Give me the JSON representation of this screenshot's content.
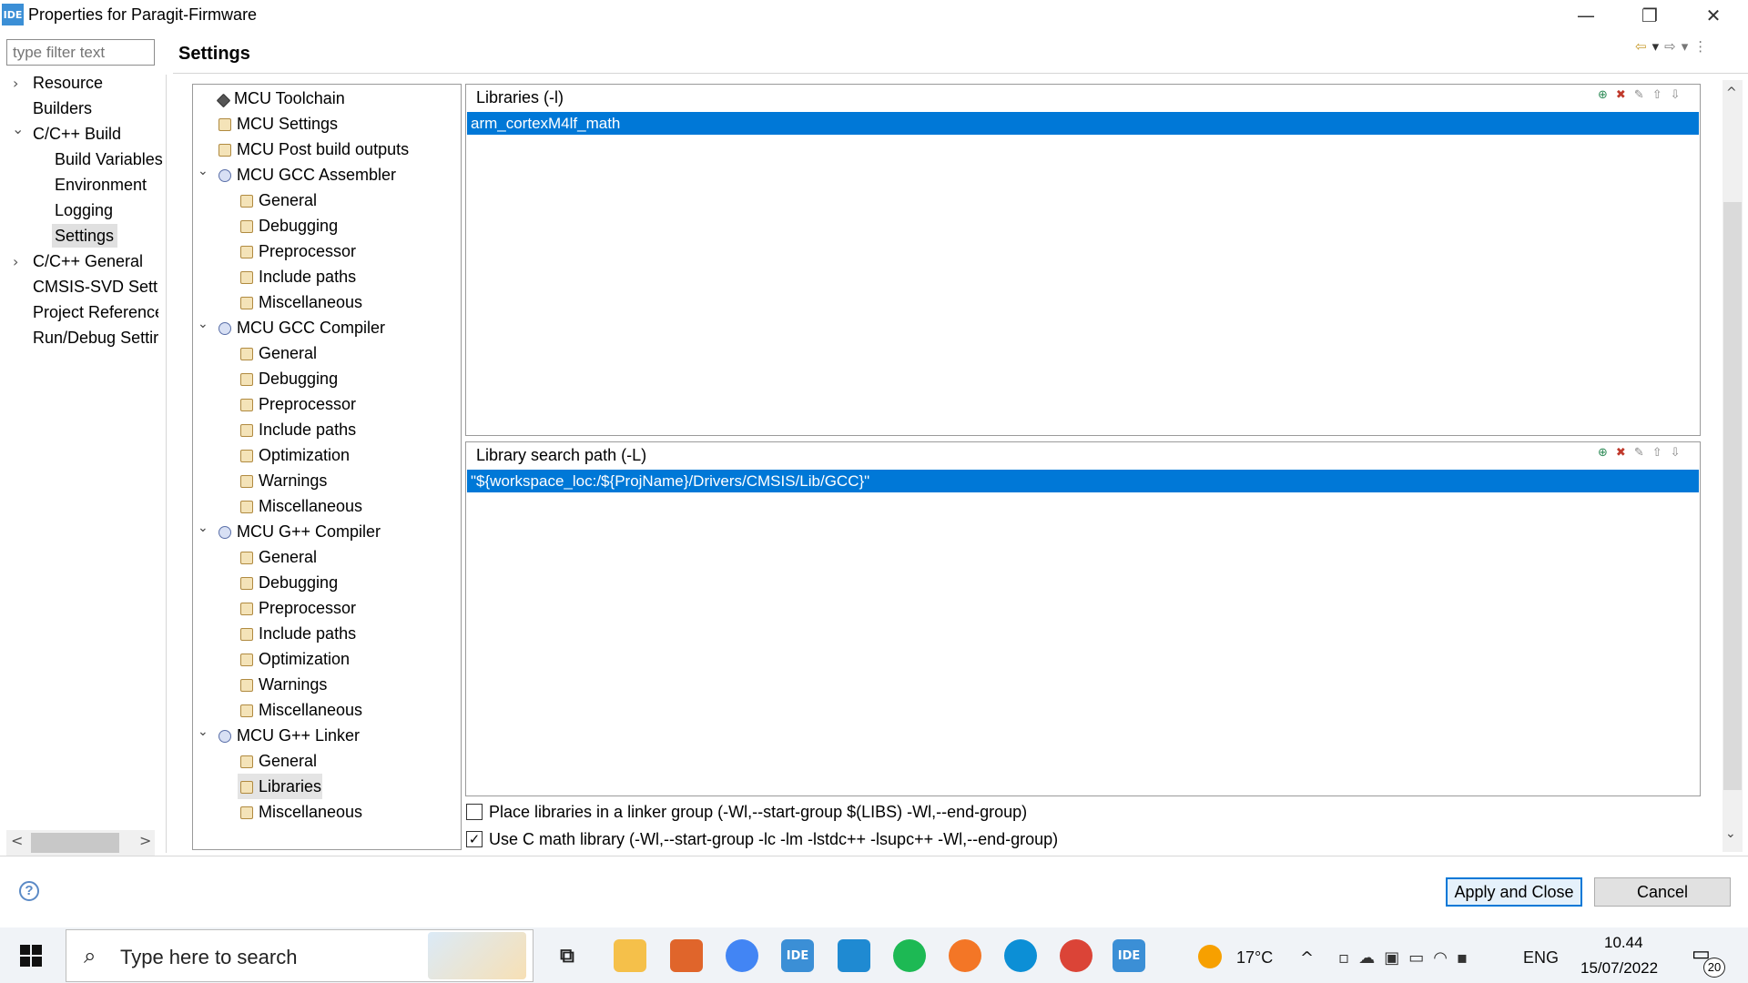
{
  "window": {
    "app_icon": "IDE",
    "title": "Properties for Paragit-Firmware",
    "minimize": "—",
    "restore": "❐",
    "close": "✕"
  },
  "sidebar": {
    "filter_placeholder": "type filter text",
    "items": [
      {
        "label": "Resource",
        "arrow": "›"
      },
      {
        "label": "Builders"
      },
      {
        "label": "C/C++ Build",
        "arrow": "⌄"
      },
      {
        "label": "Build Variables"
      },
      {
        "label": "Environment"
      },
      {
        "label": "Logging"
      },
      {
        "label": "Settings",
        "selected": true
      },
      {
        "label": "C/C++ General",
        "arrow": "›"
      },
      {
        "label": "CMSIS-SVD Settir"
      },
      {
        "label": "Project Reference:"
      },
      {
        "label": "Run/Debug Settir"
      }
    ],
    "scroll_left": "<",
    "scroll_right": ">"
  },
  "header": {
    "title": "Settings",
    "nav_icons": [
      "⇦",
      "▾",
      "⇨",
      "▾",
      "⋮"
    ]
  },
  "tree": {
    "items": [
      {
        "label": "MCU Toolchain"
      },
      {
        "label": "MCU Settings"
      },
      {
        "label": "MCU Post build outputs"
      },
      {
        "label": "MCU GCC Assembler"
      },
      {
        "label": "General"
      },
      {
        "label": "Debugging"
      },
      {
        "label": "Preprocessor"
      },
      {
        "label": "Include paths"
      },
      {
        "label": "Miscellaneous"
      },
      {
        "label": "MCU GCC Compiler"
      },
      {
        "label": "General"
      },
      {
        "label": "Debugging"
      },
      {
        "label": "Preprocessor"
      },
      {
        "label": "Include paths"
      },
      {
        "label": "Optimization"
      },
      {
        "label": "Warnings"
      },
      {
        "label": "Miscellaneous"
      },
      {
        "label": "MCU G++ Compiler"
      },
      {
        "label": "General"
      },
      {
        "label": "Debugging"
      },
      {
        "label": "Preprocessor"
      },
      {
        "label": "Include paths"
      },
      {
        "label": "Optimization"
      },
      {
        "label": "Warnings"
      },
      {
        "label": "Miscellaneous"
      },
      {
        "label": "MCU G++ Linker"
      },
      {
        "label": "General"
      },
      {
        "label": "Libraries",
        "selected": true
      },
      {
        "label": "Miscellaneous"
      }
    ],
    "chevron": "⌄"
  },
  "libraries": {
    "title": "Libraries (-l)",
    "items": [
      "arm_cortexM4lf_math"
    ]
  },
  "library_paths": {
    "title": "Library search path (-L)",
    "items": [
      "\"${workspace_loc:/${ProjName}/Drivers/CMSIS/Lib/GCC}\""
    ]
  },
  "list_toolbar": [
    "⊕",
    "✖",
    "✎",
    "⇧",
    "⇩"
  ],
  "options": {
    "linker_group": {
      "label": "Place libraries in a linker group (-Wl,--start-group $(LIBS) -Wl,--end-group)",
      "checked": false
    },
    "c_math": {
      "label": "Use C math library (-Wl,--start-group -lc -lm -lstdc++ -lsupc++ -Wl,--end-group)",
      "checked": true
    }
  },
  "scroll_up": "^",
  "scroll_down": "⌄",
  "buttons": {
    "help": "?",
    "apply": "Apply and Close",
    "cancel": "Cancel"
  },
  "taskbar": {
    "search_placeholder": "Type here to search",
    "apps": [
      "task-view",
      "file-explorer",
      "matlab",
      "chrome",
      "stm32cubeide",
      "vscode",
      "spotify",
      "jupyter",
      "edge",
      "chrome-profile",
      "stm32cubeide-active"
    ],
    "ide_label": "IDE",
    "weather": "17°C",
    "language": "ENG",
    "time": "10.44",
    "date": "15/07/2022",
    "notifications": "20"
  }
}
